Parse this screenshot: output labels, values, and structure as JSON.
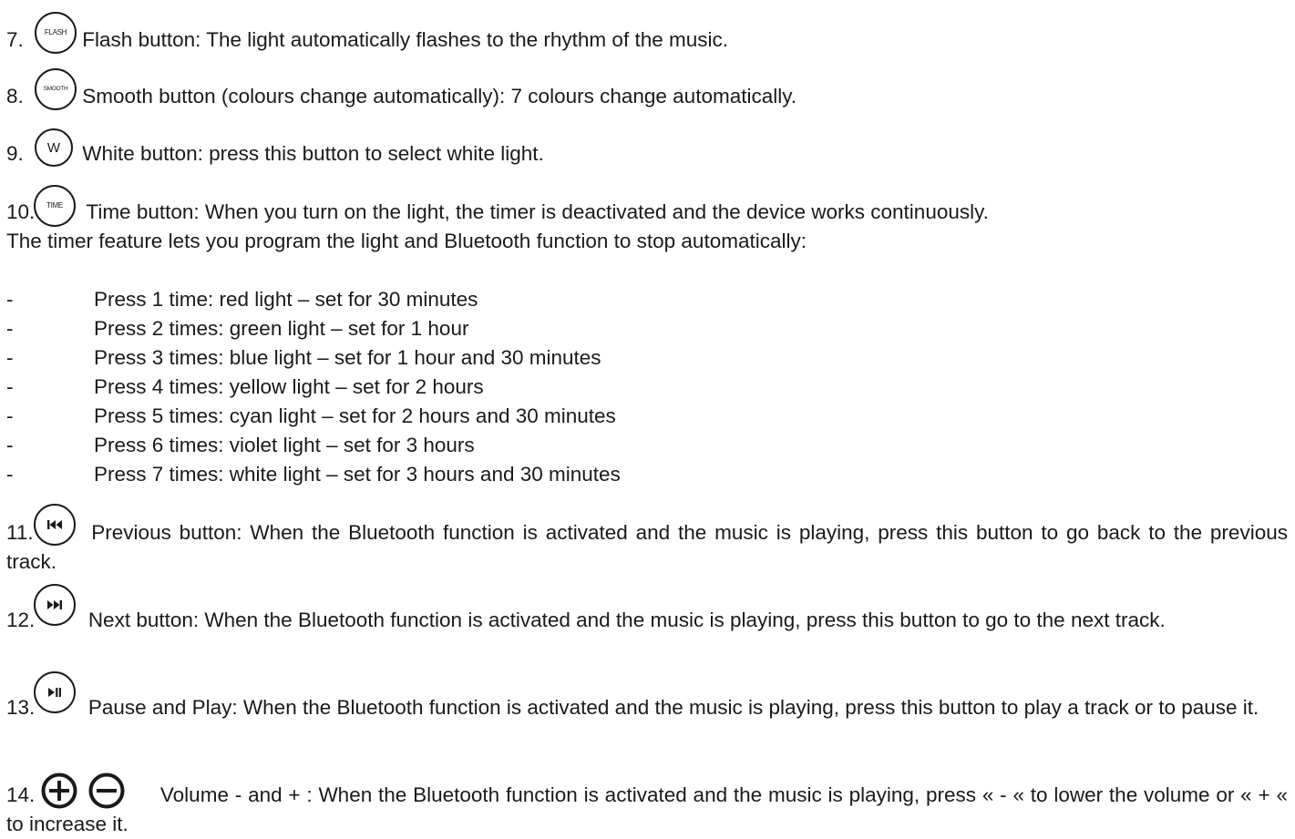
{
  "items": [
    {
      "num": "7.",
      "icon_label": "FLASH",
      "text": "Flash button: The light automatically flashes to the rhythm of the music."
    },
    {
      "num": "8.",
      "icon_label": "SMOOTH",
      "text": "Smooth button (colours change automatically): 7 colours change automatically."
    },
    {
      "num": "9.",
      "icon_label": "W",
      "text": "White button: press this button to select white light."
    },
    {
      "num": "10.",
      "icon_label": "TIME",
      "text": "Time button: When you turn on the light, the timer is deactivated and the device works continuously.",
      "note": "The timer feature lets you program the light and Bluetooth function to stop automatically:"
    },
    {
      "num": "11.",
      "icon": "previous-icon",
      "text": "Previous button: When the Bluetooth function is activated and the music is playing, press this button to go back to the previous track."
    },
    {
      "num": "12.",
      "icon": "next-icon",
      "text": "Next button: When the Bluetooth function is activated and the music is playing, press this button to go to the next track."
    },
    {
      "num": "13.",
      "icon": "play-pause-icon",
      "text": "Pause and Play: When the Bluetooth function is activated and the music is playing, press this button to play a track or to pause it."
    },
    {
      "num": "14.",
      "icons": [
        "plus-icon",
        "minus-icon"
      ],
      "text": "Volume - and + : When the Bluetooth function is activated and the music is playing, press « - « to lower the volume or « + « to increase it."
    }
  ],
  "timer_list": {
    "bullet": "-",
    "entries": [
      "Press 1 time: red light – set for 30 minutes",
      "Press 2 times: green light – set for 1 hour",
      "Press 3 times: blue light – set for 1 hour and 30 minutes",
      "Press 4 times: yellow light – set for 2 hours",
      "Press 5 times: cyan light – set for 2 hours and 30 minutes",
      "Press 6 times: violet light – set for 3 hours",
      "Press 7 times: white light – set for 3 hours and 30 minutes"
    ]
  }
}
